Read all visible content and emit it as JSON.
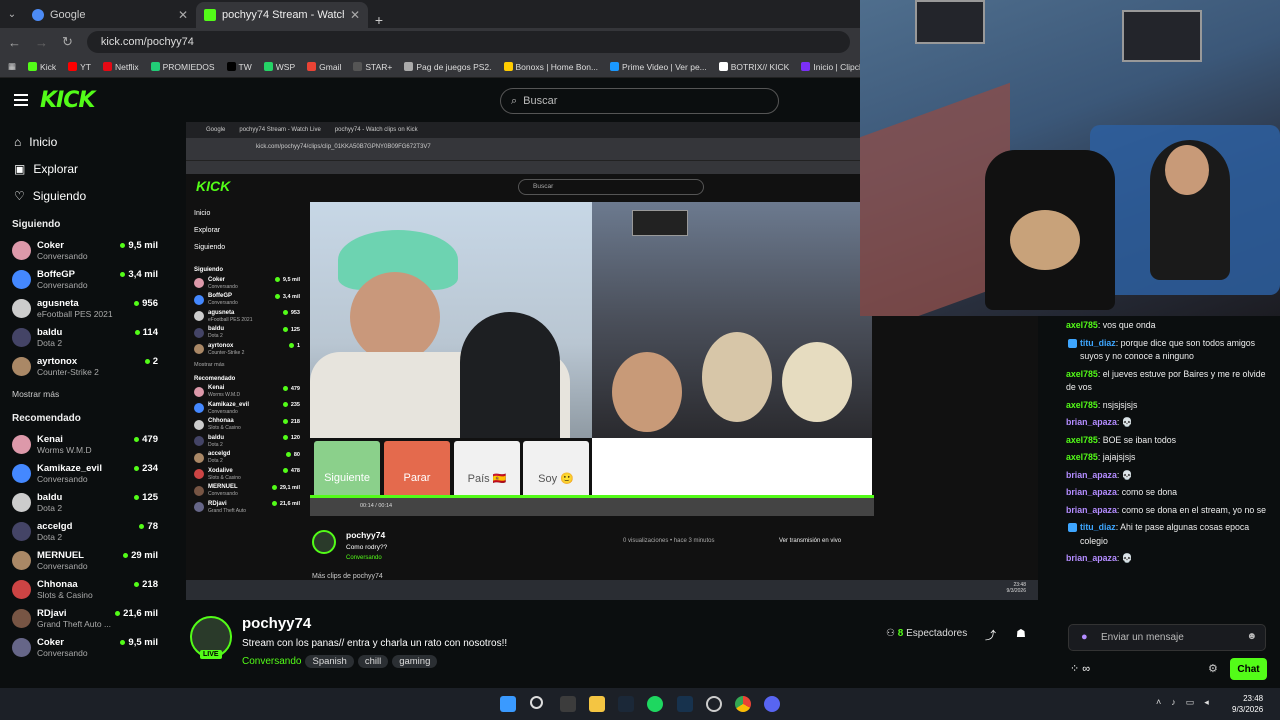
{
  "browser": {
    "tabs": [
      {
        "title": "Google",
        "active": false
      },
      {
        "title": "pochyy74 Stream - Watch Live",
        "active": true
      }
    ],
    "url": "kick.com/pochyy74",
    "bookmarks": [
      "Kick",
      "YT",
      "Netflix",
      "PROMIEDOS",
      "TW",
      "WSP",
      "Gmail",
      "STAR+",
      "Pag de juegos PS2.",
      "Bonoxs | Home Bon...",
      "Prime Video | Ver pe...",
      "BOTRIX// KICK",
      "Inicio | Clipchamp"
    ]
  },
  "header": {
    "logo": "KICK",
    "search_placeholder": "Buscar"
  },
  "nav": [
    {
      "label": "Inicio",
      "icon": "home-icon"
    },
    {
      "label": "Explorar",
      "icon": "compass-icon"
    },
    {
      "label": "Siguiendo",
      "icon": "heart-icon"
    }
  ],
  "following": {
    "title": "Siguiendo",
    "channels": [
      {
        "name": "Coker",
        "game": "Conversando",
        "viewers": "9,5 mil"
      },
      {
        "name": "BoffeGP",
        "game": "Conversando",
        "viewers": "3,4 mil"
      },
      {
        "name": "agusneta",
        "game": "eFootball PES 2021",
        "viewers": "956"
      },
      {
        "name": "baldu",
        "game": "Dota 2",
        "viewers": "114"
      },
      {
        "name": "ayrtonox",
        "game": "Counter-Strike 2",
        "viewers": "2"
      }
    ],
    "more": "Mostrar más"
  },
  "recommended": {
    "title": "Recomendado",
    "channels": [
      {
        "name": "Kenai",
        "game": "Worms W.M.D",
        "viewers": "479"
      },
      {
        "name": "Kamikaze_evil",
        "game": "Conversando",
        "viewers": "234"
      },
      {
        "name": "baldu",
        "game": "Dota 2",
        "viewers": "125"
      },
      {
        "name": "accelgd",
        "game": "Dota 2",
        "viewers": "78"
      },
      {
        "name": "MERNUEL",
        "game": "Conversando",
        "viewers": "29 mil"
      },
      {
        "name": "Chhonaa",
        "game": "Slots & Casino",
        "viewers": "218"
      },
      {
        "name": "RDjavi",
        "game": "Grand Theft Auto ...",
        "viewers": "21,6 mil"
      },
      {
        "name": "Coker",
        "game": "Conversando",
        "viewers": "9,5 mil"
      }
    ]
  },
  "inner": {
    "tabs": [
      "Google",
      "pochyy74 Stream - Watch Live",
      "pochyy74 - Watch clips on Kick"
    ],
    "url": "kick.com/pochyy74/clips/clip_01KKA50B7GPNY0B09FG672T3V7",
    "nav": [
      "Inicio",
      "Explorar",
      "Siguiendo"
    ],
    "following_title": "Siguiendo",
    "following": [
      {
        "name": "Coker",
        "game": "Conversando",
        "viewers": "9,5 mil"
      },
      {
        "name": "BoffeGP",
        "game": "Conversando",
        "viewers": "3,4 mil"
      },
      {
        "name": "agusneta",
        "game": "eFootball PES 2021",
        "viewers": "953"
      },
      {
        "name": "baldu",
        "game": "Dota 2",
        "viewers": "125"
      },
      {
        "name": "ayrtonox",
        "game": "Counter-Strike 2",
        "viewers": "1"
      }
    ],
    "more": "Mostrar más",
    "recommended_title": "Recomendado",
    "recommended": [
      {
        "name": "Kenai",
        "game": "Worms W.M.D",
        "viewers": "479"
      },
      {
        "name": "Kamikaze_evil",
        "game": "Conversando",
        "viewers": "235"
      },
      {
        "name": "Chhonaa",
        "game": "Slots & Casino",
        "viewers": "218"
      },
      {
        "name": "baldu",
        "game": "Dota 2",
        "viewers": "120"
      },
      {
        "name": "accelgd",
        "game": "Dota 2",
        "viewers": "80"
      },
      {
        "name": "Xodalive",
        "game": "Slots & Casino",
        "viewers": "478"
      },
      {
        "name": "MERNUEL",
        "game": "Conversando",
        "viewers": "29,1 mil"
      },
      {
        "name": "RDjavi",
        "game": "Grand Theft Auto",
        "viewers": "21,6 mil"
      }
    ],
    "buttons": [
      "Siguiente",
      "Parar",
      "País 🇪🇸",
      "Soy 🙂"
    ],
    "time": "00:14 / 00:14",
    "clip_author": "pochyy74",
    "clip_title": "Como rodry??",
    "clip_cat": "Conversando",
    "views": "0 visualizaciones • hace 3 minutos",
    "ver_btn": "Ver transmisión en vivo",
    "more_clips": "Más clips de pochyy74",
    "taskbar_time": "23:48",
    "taskbar_date": "9/3/2026"
  },
  "stream": {
    "name": "pochyy74",
    "title": "Stream con los panas// entra y charla un rato con nosotros!!",
    "category": "Conversando",
    "tags": [
      "Spanish",
      "chill",
      "gaming"
    ],
    "viewers_count": "8",
    "viewers_label": "Espectadores",
    "live_badge": "LIVE"
  },
  "chat": {
    "messages": [
      {
        "user": "axel785",
        "text": "vos que onda",
        "color": "#53fc18",
        "badge": false
      },
      {
        "user": "titu_diaz",
        "text": "porque dice que son todos amigos suyos y no conoce a ninguno",
        "color": "#3ea6ff",
        "badge": true
      },
      {
        "user": "axel785",
        "text": "el jueves estuve por Baires y me re olvide de vos",
        "color": "#53fc18",
        "badge": false
      },
      {
        "user": "axel785",
        "text": "nsjsjsjsjs",
        "color": "#53fc18",
        "badge": false
      },
      {
        "user": "brian_apaza",
        "text": "💀",
        "color": "#b38cff",
        "badge": false
      },
      {
        "user": "axel785",
        "text": "BOE se iban todos",
        "color": "#53fc18",
        "badge": false
      },
      {
        "user": "axel785",
        "text": "jajajsjsjs",
        "color": "#53fc18",
        "badge": false
      },
      {
        "user": "brian_apaza",
        "text": "💀",
        "color": "#b38cff",
        "badge": false
      },
      {
        "user": "brian_apaza",
        "text": "como se dona",
        "color": "#b38cff",
        "badge": false
      },
      {
        "user": "brian_apaza",
        "text": "como se dona en el stream, yo no se",
        "color": "#b38cff",
        "badge": false
      },
      {
        "user": "titu_diaz",
        "text": "Ahi te pase algunas cosas epoca colegio",
        "color": "#3ea6ff",
        "badge": true
      },
      {
        "user": "brian_apaza",
        "text": "💀",
        "color": "#b38cff",
        "badge": false
      }
    ],
    "input_placeholder": "Enviar un mensaje",
    "send_label": "Chat",
    "points": "∞"
  },
  "taskbar": {
    "time": "23:48",
    "date": "9/3/2026"
  },
  "colors": {
    "accent": "#53fc18",
    "background": "#0b0e0f"
  }
}
